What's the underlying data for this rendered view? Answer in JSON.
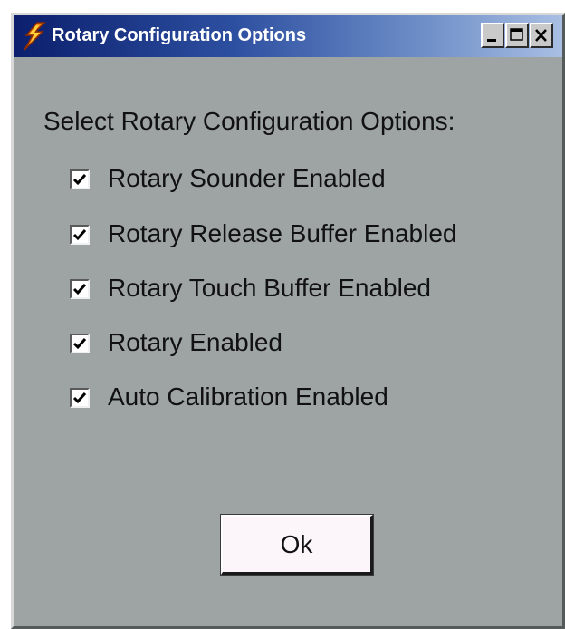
{
  "window": {
    "title": "Rotary Configuration Options",
    "app_icon": "lightning-bolt-icon",
    "controls": {
      "minimize": "minimize-icon",
      "maximize": "maximize-icon",
      "close": "close-icon"
    }
  },
  "main": {
    "prompt": "Select Rotary Configuration Options:",
    "options": [
      {
        "label": "Rotary Sounder Enabled",
        "checked": true
      },
      {
        "label": "Rotary Release Buffer Enabled",
        "checked": true
      },
      {
        "label": "Rotary Touch Buffer Enabled",
        "checked": true
      },
      {
        "label": "Rotary Enabled",
        "checked": true
      },
      {
        "label": "Auto Calibration Enabled",
        "checked": true
      }
    ],
    "ok_label": "Ok"
  },
  "colors": {
    "dialog_background": "#9ea4a4",
    "titlebar_start": "#0b1f6d",
    "titlebar_end": "#a9bfe3",
    "button_face": "#fcf6fb"
  }
}
